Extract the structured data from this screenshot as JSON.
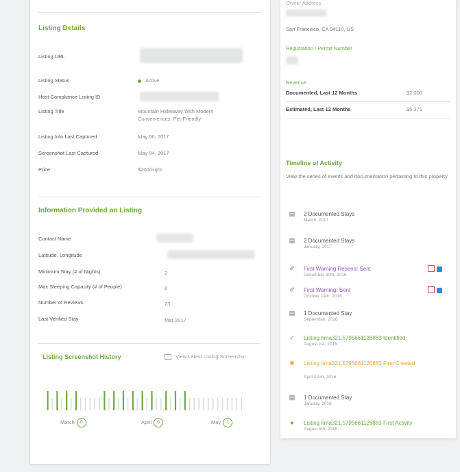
{
  "left": {
    "listing_details": {
      "title": "Listing Details",
      "rows": [
        {
          "label": "Listing URL",
          "value": ""
        },
        {
          "label": "Listing Status",
          "value": "Active"
        },
        {
          "label": "Host Compliance Listing ID",
          "value": ""
        },
        {
          "label": "Listing Title",
          "value": "Mountain Hideaway With Modern Conveniences, Pet-Friendly"
        },
        {
          "label": "Listing Info Last Captured",
          "value": "May 06, 2017"
        },
        {
          "label": "Screenshot Last Captured",
          "value": "May 04, 2017"
        },
        {
          "label": "Price",
          "value": "$200/night"
        }
      ]
    },
    "info_provided": {
      "title": "Information Provided on Listing",
      "rows": [
        {
          "label": "Contact Name",
          "value": ""
        },
        {
          "label": "Latitude, Longitude",
          "value": ""
        },
        {
          "label": "Minimum Stay (# of Nights)",
          "value": "2"
        },
        {
          "label": "Max Sleeping Capacity (# of People)",
          "value": "8"
        },
        {
          "label": "Number of Reviews",
          "value": "23"
        },
        {
          "label": "Last Verified Stay",
          "value": "Mar 2017"
        }
      ]
    },
    "screenshot_history": {
      "title": "Listing Screenshot History",
      "view_latest_label": "View Latest Listing Screenshot",
      "bars": [
        1,
        0,
        1,
        0,
        1,
        0,
        1,
        0,
        0,
        0,
        0,
        0,
        1,
        0,
        1,
        0,
        1,
        0,
        1,
        0,
        1,
        0,
        1,
        0,
        0,
        1,
        0,
        1,
        0,
        1,
        0,
        0,
        0,
        0,
        0,
        0,
        0,
        0,
        0,
        0,
        0,
        0
      ],
      "months": [
        {
          "name": "March",
          "count": "6"
        },
        {
          "name": "April",
          "count": "6"
        },
        {
          "name": "May",
          "count": "1"
        }
      ]
    }
  },
  "right": {
    "owner_address_label": "Owner Address",
    "address": "San Francisco, CA 94110, US",
    "registration_label": "Registration / Permit Number",
    "revenue": {
      "title": "Revenue",
      "rows": [
        {
          "label": "Documented, Last 12 Months",
          "value": "$2,000"
        },
        {
          "label": "Estimated, Last 12 Months",
          "value": "$5,371"
        }
      ]
    },
    "timeline": {
      "title": "Timeline of Activity",
      "description": "View the series of events and documentation pertaining to this property",
      "items": [
        {
          "icon": "calendar-icon",
          "glyph": "▤",
          "title": "2 Documented Stays",
          "date": "March, 2017",
          "style": "plain"
        },
        {
          "icon": "calendar-icon",
          "glyph": "▤",
          "title": "2 Documented Stays",
          "date": "January, 2017",
          "style": "plain"
        },
        {
          "icon": "letter-icon",
          "glyph": "✐",
          "title": "First Warning Resend: Sent",
          "date": "December 30th, 2016",
          "style": "purple",
          "actions": true
        },
        {
          "icon": "letter-icon",
          "glyph": "✐",
          "title": "First Warning: Sent",
          "date": "October 14th, 2016",
          "style": "purple",
          "actions": true
        },
        {
          "icon": "calendar-icon",
          "glyph": "▤",
          "title": "1 Documented Stay",
          "date": "September, 2016",
          "style": "plain"
        },
        {
          "icon": "check-icon",
          "glyph": "✓",
          "title": "Listing hma321.5795661126883 Identified",
          "date": "August 1st, 2016",
          "style": "green"
        },
        {
          "icon": "star-icon",
          "glyph": "✱",
          "title": "Listing hma321.5795661126883 First Created",
          "date": "April 22nd, 2016",
          "style": "orange"
        },
        {
          "icon": "calendar-icon",
          "glyph": "▤",
          "title": "1 Documented Stay",
          "date": "January, 2016",
          "style": "plain"
        },
        {
          "icon": "dot-icon",
          "glyph": "●",
          "title": "Listing hma321.5795661126883 First Activity",
          "date": "August 5th, 2015",
          "style": "green"
        }
      ]
    }
  },
  "colors": {
    "accent": "#6fa93f",
    "purple": "#8a5ec4",
    "orange": "#f0a030",
    "mail": "#3d85d6",
    "calendar": "#d1495b"
  }
}
